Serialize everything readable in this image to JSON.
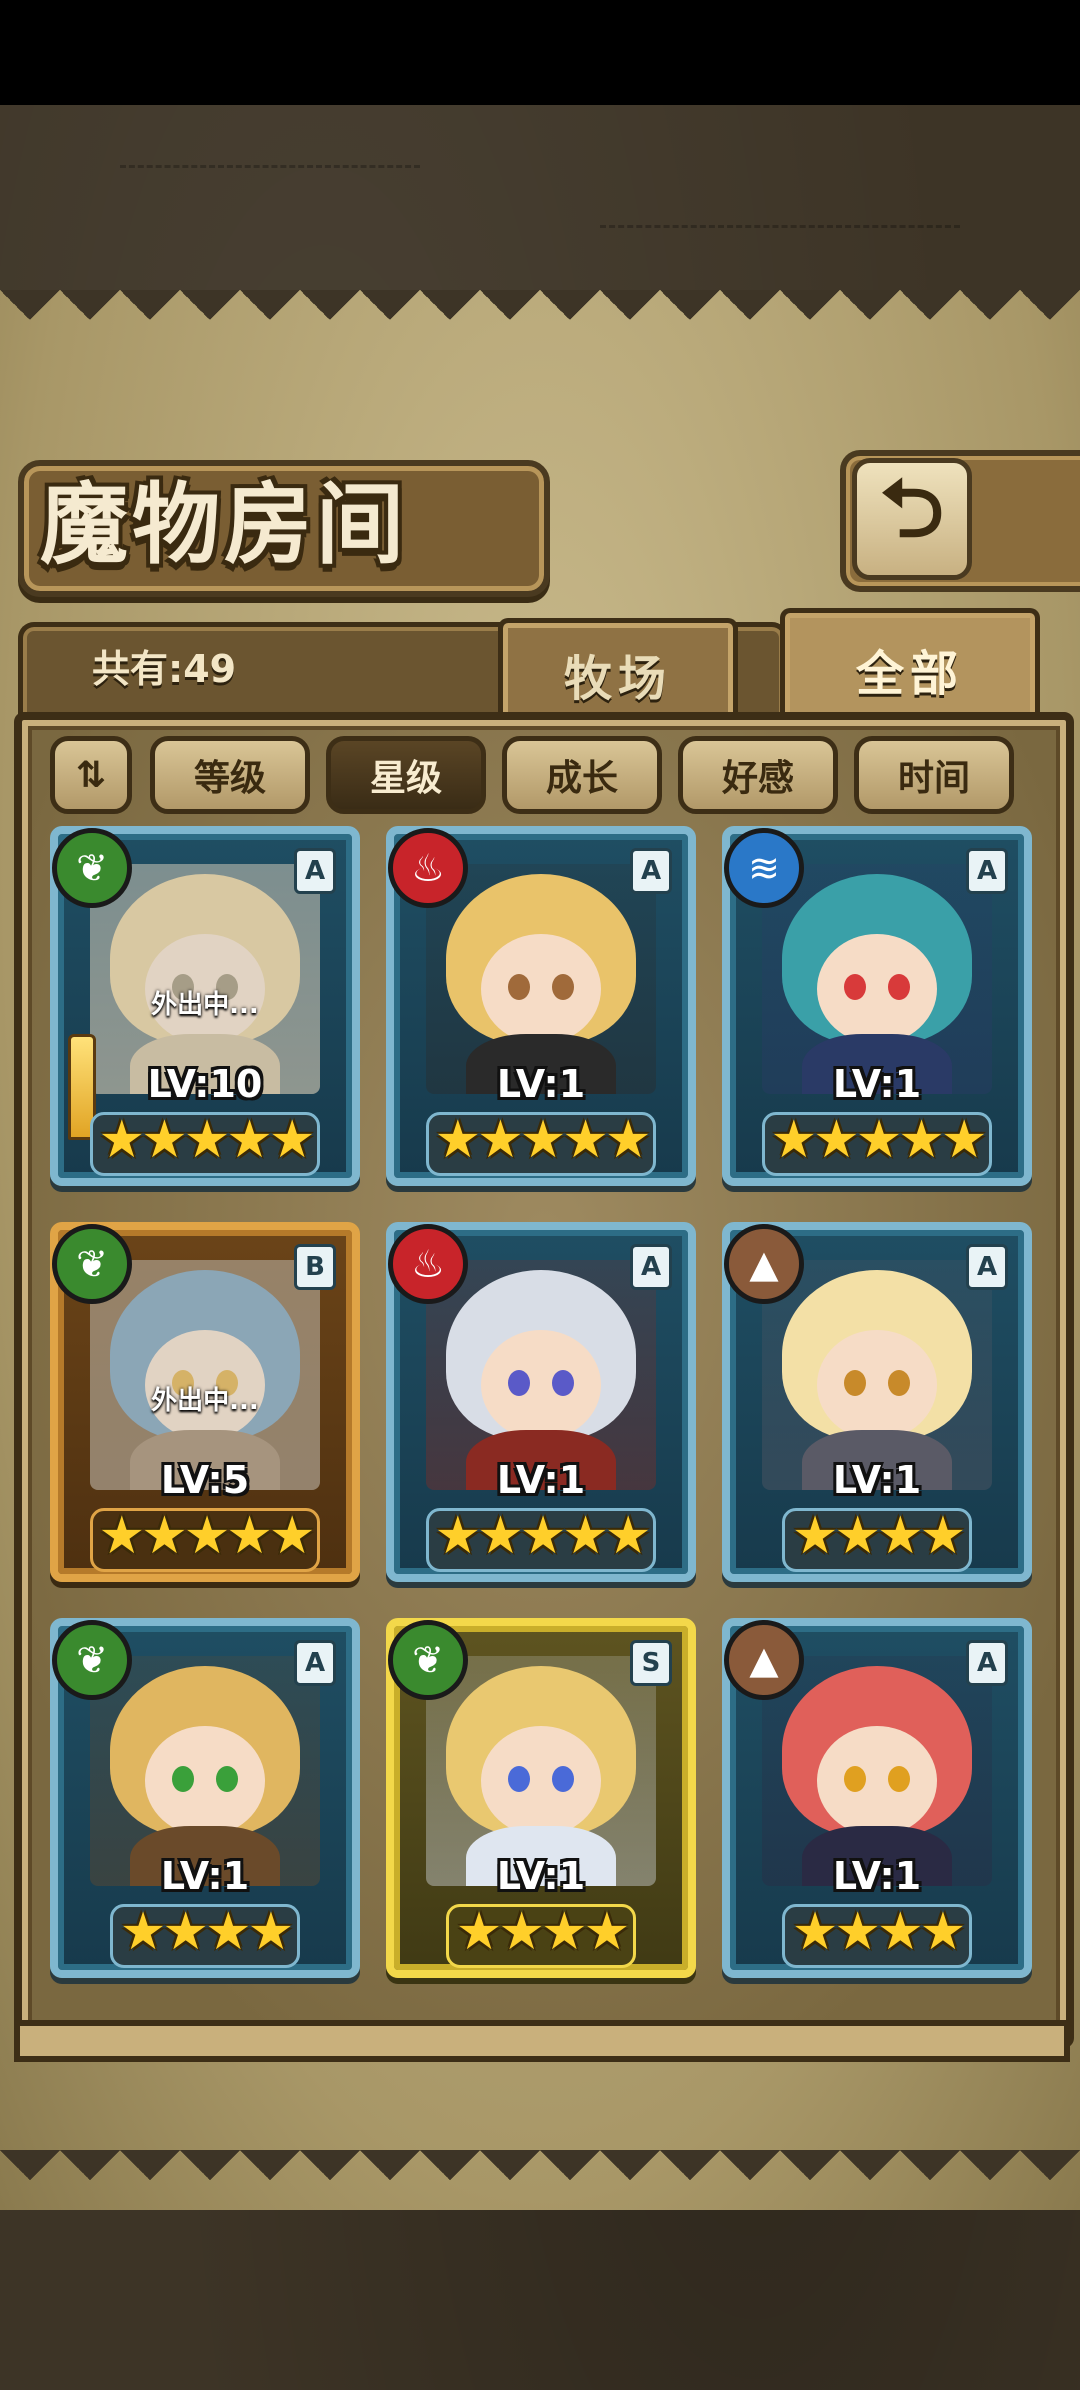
{
  "header": {
    "title": "魔物房间",
    "return_icon": "return-arrow-icon"
  },
  "tabs": {
    "count_label": "共有:49",
    "items": [
      {
        "label": "牧场",
        "active": false
      },
      {
        "label": "全部",
        "active": true
      }
    ]
  },
  "sort": {
    "toggle_icon": "sort-direction-icon",
    "options": [
      {
        "label": "等级",
        "active": false
      },
      {
        "label": "星级",
        "active": true
      },
      {
        "label": "成长",
        "active": false
      },
      {
        "label": "好感",
        "active": false
      },
      {
        "label": "时间",
        "active": false
      }
    ]
  },
  "cards": [
    {
      "element": "nature",
      "element_icon": "leaf-icon",
      "grade": "A",
      "level": "LV:10",
      "stars": "★★★★★",
      "star_count": 5,
      "frame": "blue",
      "away": "外出中...",
      "weapon": true,
      "hair": "#e6c98a",
      "eye": "#8a7a5a",
      "outfit": "#c9b38a"
    },
    {
      "element": "fire",
      "element_icon": "flame-icon",
      "grade": "A",
      "level": "LV:1",
      "stars": "★★★★★",
      "star_count": 5,
      "frame": "blue",
      "away": "",
      "weapon": false,
      "hair": "#e9c36a",
      "eye": "#a06a3a",
      "outfit": "#2a2a2a"
    },
    {
      "element": "water",
      "element_icon": "water-icon",
      "grade": "A",
      "level": "LV:1",
      "stars": "★★★★★",
      "star_count": 5,
      "frame": "blue",
      "away": "",
      "weapon": false,
      "hair": "#3aa0a8",
      "eye": "#d83a3a",
      "outfit": "#2a3a66"
    },
    {
      "element": "nature",
      "element_icon": "leaf-icon",
      "grade": "B",
      "level": "LV:5",
      "stars": "★★★★★",
      "star_count": 5,
      "frame": "gold",
      "away": "外出中...",
      "weapon": false,
      "hair": "#5a8ab0",
      "eye": "#e0a020",
      "outfit": "#8a6a4a"
    },
    {
      "element": "fire",
      "element_icon": "flame-icon",
      "grade": "A",
      "level": "LV:1",
      "stars": "★★★★★",
      "star_count": 5,
      "frame": "blue",
      "away": "",
      "weapon": false,
      "hair": "#d8dde6",
      "eye": "#5a5ac8",
      "outfit": "#8a2a22"
    },
    {
      "element": "earth",
      "element_icon": "mountain-icon",
      "grade": "A",
      "level": "LV:1",
      "stars": "★★★★",
      "star_count": 4,
      "frame": "blue",
      "away": "",
      "weapon": false,
      "hair": "#f3e0a6",
      "eye": "#c88a2a",
      "outfit": "#5a5a66"
    },
    {
      "element": "nature",
      "element_icon": "leaf-icon",
      "grade": "A",
      "level": "LV:1",
      "stars": "★★★★",
      "star_count": 4,
      "frame": "blue",
      "away": "",
      "weapon": false,
      "hair": "#e0b660",
      "eye": "#3aa03a",
      "outfit": "#6a4a2a"
    },
    {
      "element": "nature",
      "element_icon": "leaf-icon",
      "grade": "S",
      "level": "LV:1",
      "stars": "★★★★",
      "star_count": 4,
      "frame": "yellow",
      "away": "",
      "weapon": false,
      "hair": "#e9c870",
      "eye": "#4a6ad8",
      "outfit": "#dfe6f0"
    },
    {
      "element": "earth",
      "element_icon": "mountain-icon",
      "grade": "A",
      "level": "LV:1",
      "stars": "★★★★",
      "star_count": 4,
      "frame": "blue",
      "away": "",
      "weapon": false,
      "hair": "#e0605a",
      "eye": "#e0a020",
      "outfit": "#2a2a44"
    }
  ]
}
